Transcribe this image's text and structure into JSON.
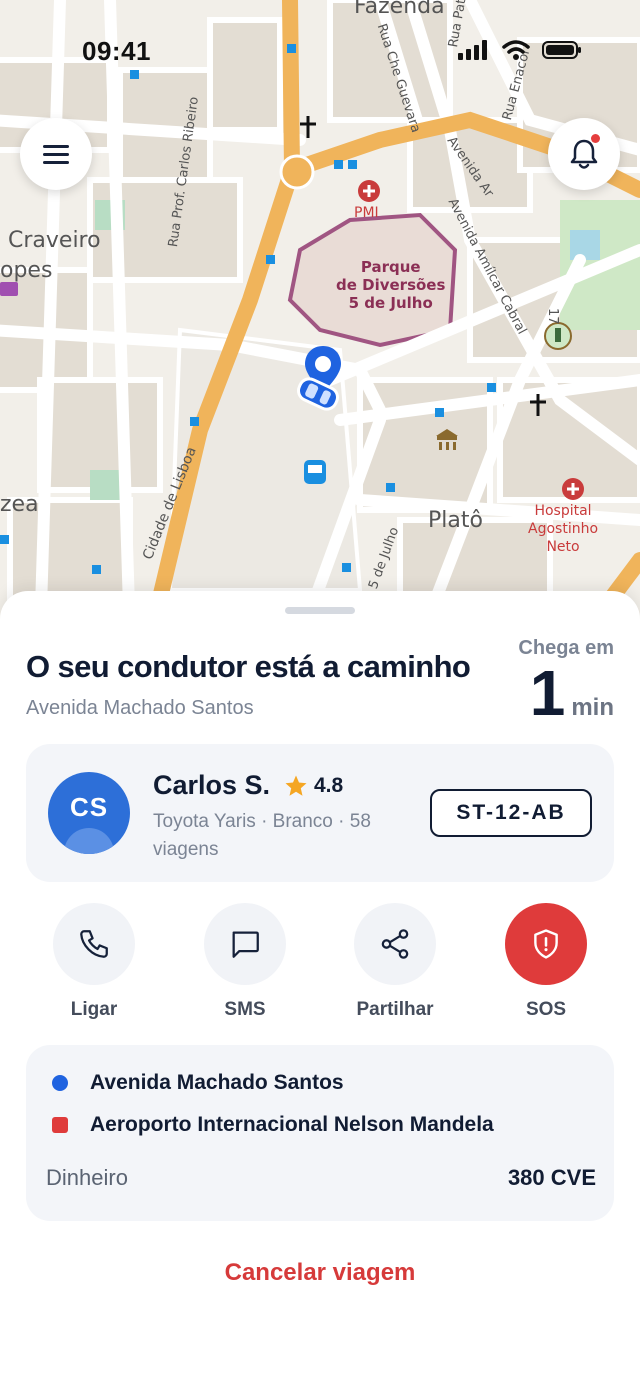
{
  "status_bar": {
    "time": "09:41",
    "icons": [
      "signal-icon",
      "wifi-icon",
      "battery-icon"
    ]
  },
  "map": {
    "labels": {
      "fazenda": "Fazenda",
      "craveiro": "Craveiro",
      "lopes": "opes",
      "zea": "zea",
      "plato": "Platô",
      "pmi": "PMI",
      "parque": "Parque\nde Diversões\n5 de Julho",
      "hospital": "Hospital\nAgostinho\nNeto",
      "rua_che": "Rua Che Guevara",
      "rua_patoti": "Rua Patoti",
      "rua_enacol": "Rua Enacol",
      "rua_carlos": "Rua Prof. Carlos Ribeiro",
      "av_amilcar": "Avenida Amílcar Cabral",
      "av_ar": "Avenida Ar",
      "cidade_lisboa": "Cidade de Lisboa",
      "cinco_julho": "5 de Julho",
      "num_17": "17"
    },
    "colors": {
      "background": "#f2efe9",
      "main_road": "#f0b45b",
      "pin": "#1f63e0",
      "poi": "#8b2f55",
      "bus_stop": "#1a8fe0"
    }
  },
  "header_buttons": {
    "menu_icon": "menu-icon",
    "bell_icon": "bell-icon"
  },
  "trip": {
    "title": "O seu condutor está a caminho",
    "pickup_street": "Avenida Machado Santos",
    "eta_label": "Chega em",
    "eta_value": "1",
    "eta_unit": "min"
  },
  "driver": {
    "initials": "CS",
    "name": "Carlos S.",
    "rating": "4.8",
    "vehicle": "Toyota Yaris · Branco · 58 viagens",
    "plate": "ST-12-AB"
  },
  "actions": [
    {
      "label": "Ligar",
      "icon": "phone-icon"
    },
    {
      "label": "SMS",
      "icon": "message-icon"
    },
    {
      "label": "Partilhar",
      "icon": "share-icon"
    },
    {
      "label": "SOS",
      "icon": "shield-alert-icon"
    }
  ],
  "route": {
    "origin": "Avenida Machado Santos",
    "destination": "Aeroporto Internacional Nelson Mandela",
    "payment_method": "Dinheiro",
    "price": "380 CVE"
  },
  "cancel_label": "Cancelar viagem",
  "colors": {
    "accent_blue": "#1f63e0",
    "danger_red": "#df3b3b",
    "text_dark": "#111c33",
    "text_muted": "#7b8494",
    "card_bg": "#f3f5f9",
    "star": "#f5a623"
  }
}
